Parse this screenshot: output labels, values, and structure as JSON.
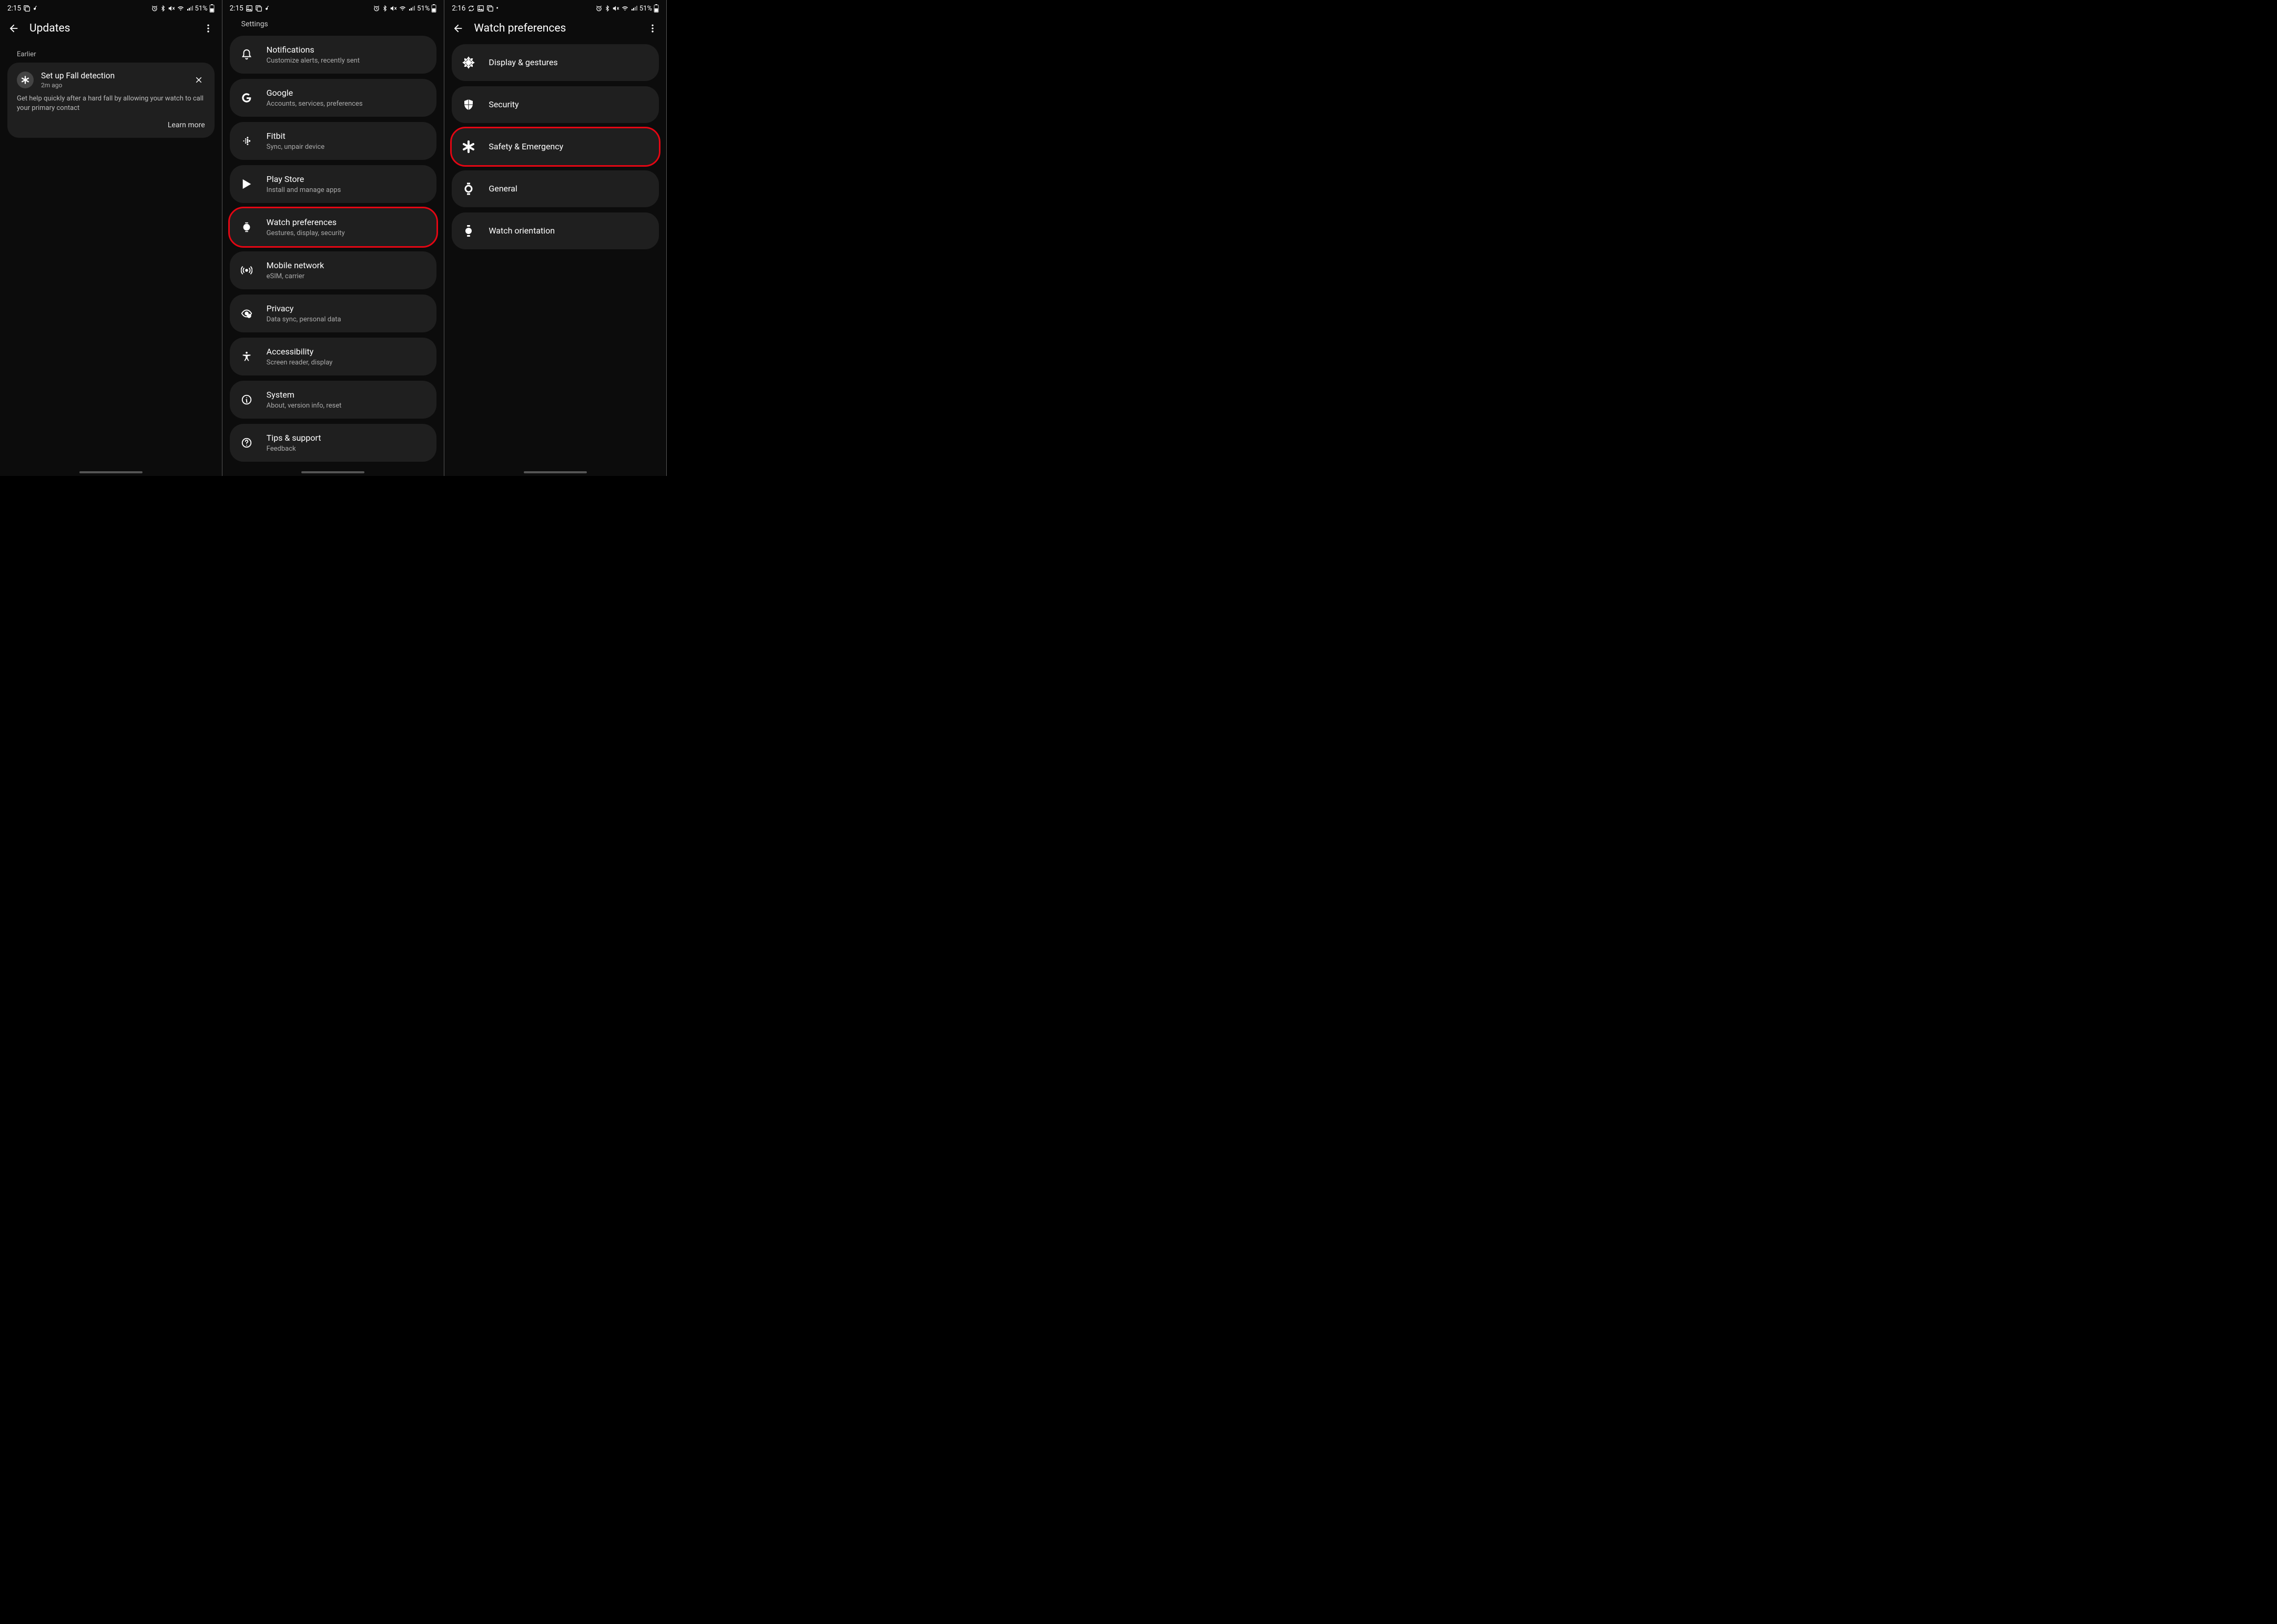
{
  "screens": [
    {
      "status": {
        "time": "2:15",
        "battery_pct": "51%"
      },
      "header": {
        "title": "Updates"
      },
      "subheader": "Earlier",
      "card": {
        "title": "Set up Fall detection",
        "time": "2m ago",
        "body": "Get help quickly after a hard fall by allowing your watch to call your primary contact",
        "action": "Learn more"
      }
    },
    {
      "status": {
        "time": "2:15",
        "battery_pct": "51%"
      },
      "settings_label": "Settings",
      "items": [
        {
          "title": "Notifications",
          "sub": "Customize alerts, recently sent",
          "highlight": false
        },
        {
          "title": "Google",
          "sub": "Accounts, services, preferences",
          "highlight": false
        },
        {
          "title": "Fitbit",
          "sub": "Sync, unpair device",
          "highlight": false
        },
        {
          "title": "Play Store",
          "sub": "Install and manage apps",
          "highlight": false
        },
        {
          "title": "Watch preferences",
          "sub": "Gestures, display, security",
          "highlight": true
        },
        {
          "title": "Mobile network",
          "sub": "eSIM, carrier",
          "highlight": false
        },
        {
          "title": "Privacy",
          "sub": "Data sync, personal data",
          "highlight": false
        },
        {
          "title": "Accessibility",
          "sub": "Screen reader, display",
          "highlight": false
        },
        {
          "title": "System",
          "sub": "About, version info, reset",
          "highlight": false
        },
        {
          "title": "Tips & support",
          "sub": "Feedback",
          "highlight": false
        }
      ]
    },
    {
      "status": {
        "time": "2:16",
        "battery_pct": "51%"
      },
      "header": {
        "title": "Watch preferences"
      },
      "items": [
        {
          "title": "Display & gestures",
          "highlight": false
        },
        {
          "title": "Security",
          "highlight": false
        },
        {
          "title": "Safety & Emergency",
          "highlight": true
        },
        {
          "title": "General",
          "highlight": false
        },
        {
          "title": "Watch orientation",
          "highlight": false
        }
      ]
    }
  ]
}
